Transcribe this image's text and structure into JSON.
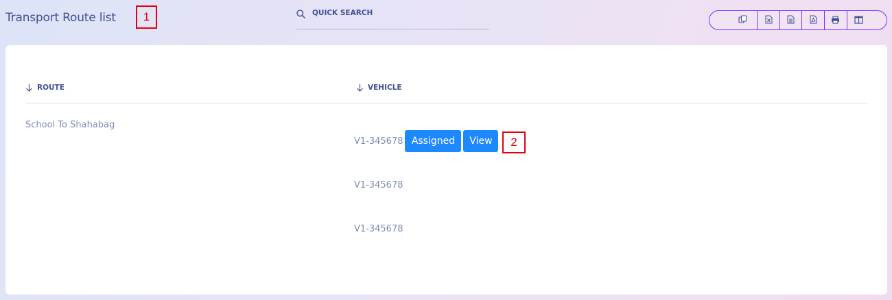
{
  "header": {
    "title": "Transport Route list",
    "annotation_1": "1",
    "annotation_2": "2"
  },
  "search": {
    "placeholder": "QUICK SEARCH",
    "icon": "search-icon"
  },
  "export_buttons": [
    {
      "name": "copy",
      "icon": "copy-icon"
    },
    {
      "name": "excel",
      "icon": "excel-icon"
    },
    {
      "name": "csv",
      "icon": "csv-icon"
    },
    {
      "name": "pdf",
      "icon": "pdf-icon"
    },
    {
      "name": "print",
      "icon": "print-icon"
    },
    {
      "name": "columns",
      "icon": "columns-icon"
    }
  ],
  "table": {
    "columns": [
      {
        "label": "ROUTE",
        "sort_icon": "arrow-down-icon"
      },
      {
        "label": "VEHICLE",
        "sort_icon": "arrow-down-icon"
      }
    ],
    "rows": [
      {
        "route": "School To Shahabag",
        "vehicles": [
          {
            "number": "V1-345678",
            "actions": [
              "Assigned",
              "View"
            ]
          },
          {
            "number": "V1-345678",
            "actions": []
          },
          {
            "number": "V1-345678",
            "actions": []
          }
        ]
      }
    ]
  },
  "colors": {
    "primary_text": "#415094",
    "muted_text": "#828bb2",
    "button_blue": "#1e88ff",
    "outline_purple": "#7c32ff",
    "annotation_red": "#e3000b"
  }
}
